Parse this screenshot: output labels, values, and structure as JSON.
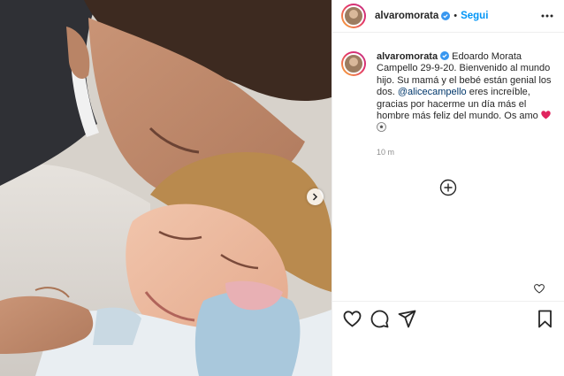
{
  "post": {
    "media_alt": "",
    "carousel_next_icon": "chevron-right-icon"
  },
  "header": {
    "username": "alvaromorata",
    "separator": "•",
    "follow_label": "Segui",
    "verified_icon": "verified-badge-icon",
    "more_icon": "more-horizontal-icon"
  },
  "caption": {
    "username": "alvaromorata",
    "text_part1": " Edoardo Morata Campello 29-9-20. Bienvenido al mundo hijo. Su mamá y el bebé están genial los dos. ",
    "mention": "@alicecampello",
    "text_part2": " eres increíble, gracias por hacerme un día más el hombre más feliz del mundo. Os amo ",
    "emojis": [
      "red-heart-icon",
      "soccer-ball-icon"
    ],
    "timestamp": "10 m"
  },
  "comments": {
    "load_more_icon": "plus-circle-icon",
    "like_icon": "heart-small-icon"
  },
  "actions": {
    "icons": [
      "heart-icon",
      "comment-icon",
      "share-icon",
      "bookmark-icon"
    ]
  },
  "colors": {
    "link": "#0095f6",
    "mention": "#00376b",
    "text": "#262626",
    "muted": "#8e8e8e",
    "heart": "#ed4956"
  }
}
